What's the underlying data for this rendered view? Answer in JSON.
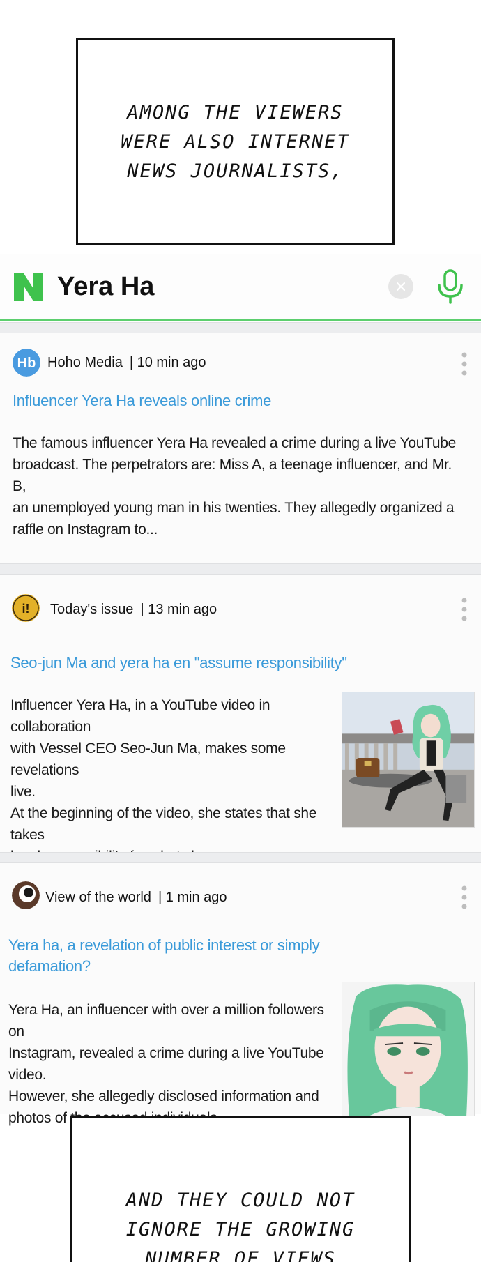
{
  "caption_top": {
    "text": "AMONG THE VIEWERS\nWERE ALSO INTERNET\n NEWS JOURNALISTS,"
  },
  "search": {
    "query": "Yera Ha",
    "accent": "#5ccf6e"
  },
  "articles": [
    {
      "source": "Hoho Media",
      "time": "| 10 min ago",
      "avatar_icon": "hoho-media-logo",
      "avatar_color": "#4a9be0",
      "headline": "Influencer Yera Ha reveals online crime",
      "snippet": [
        "The famous influencer Yera Ha revealed a crime during a live YouTube",
        "broadcast. The perpetrators are: Miss A, a teenage influencer, and Mr. B,",
        "an unemployed young man in his twenties. They allegedly organized a",
        "raffle on Instagram to..."
      ]
    },
    {
      "source": "Today's issue",
      "time": "| 13 min ago",
      "avatar_icon": "todays-issue-logo",
      "avatar_color": "#e3b128",
      "headline": "Seo-jun Ma and yera ha en \"assume responsibility\"",
      "snippet": [
        "Influencer Yera Ha, in a YouTube video in collaboration",
        "with Vessel CEO Seo-Jun Ma, makes some revelations",
        "live.",
        "At the beginning of the video, she states that she takes",
        "legal responsibility for what she says..."
      ],
      "thumbnail": "green-haired-woman-seated-thumbnail"
    },
    {
      "source": "View of the world",
      "time": "| 1 min ago",
      "avatar_icon": "view-of-the-world-eye-logo",
      "avatar_color": "#5b3a2a",
      "headline": "Yera ha, a revelation of public interest or simply defamation?",
      "headline_lines": [
        "Yera ha, a revelation of public interest or simply",
        "defamation?"
      ],
      "snippet": [
        "Yera Ha, an influencer with over a million followers on",
        "Instagram, revealed a crime during a live YouTube video.",
        "However, she allegedly disclosed information and",
        "photos of the accused individuals..."
      ],
      "thumbnail": "green-haired-woman-portrait-thumbnail"
    }
  ],
  "caption_bottom": {
    "text": "AND THEY COULD NOT\nIGNORE THE GROWING\nNUMBER OF VIEWS"
  }
}
